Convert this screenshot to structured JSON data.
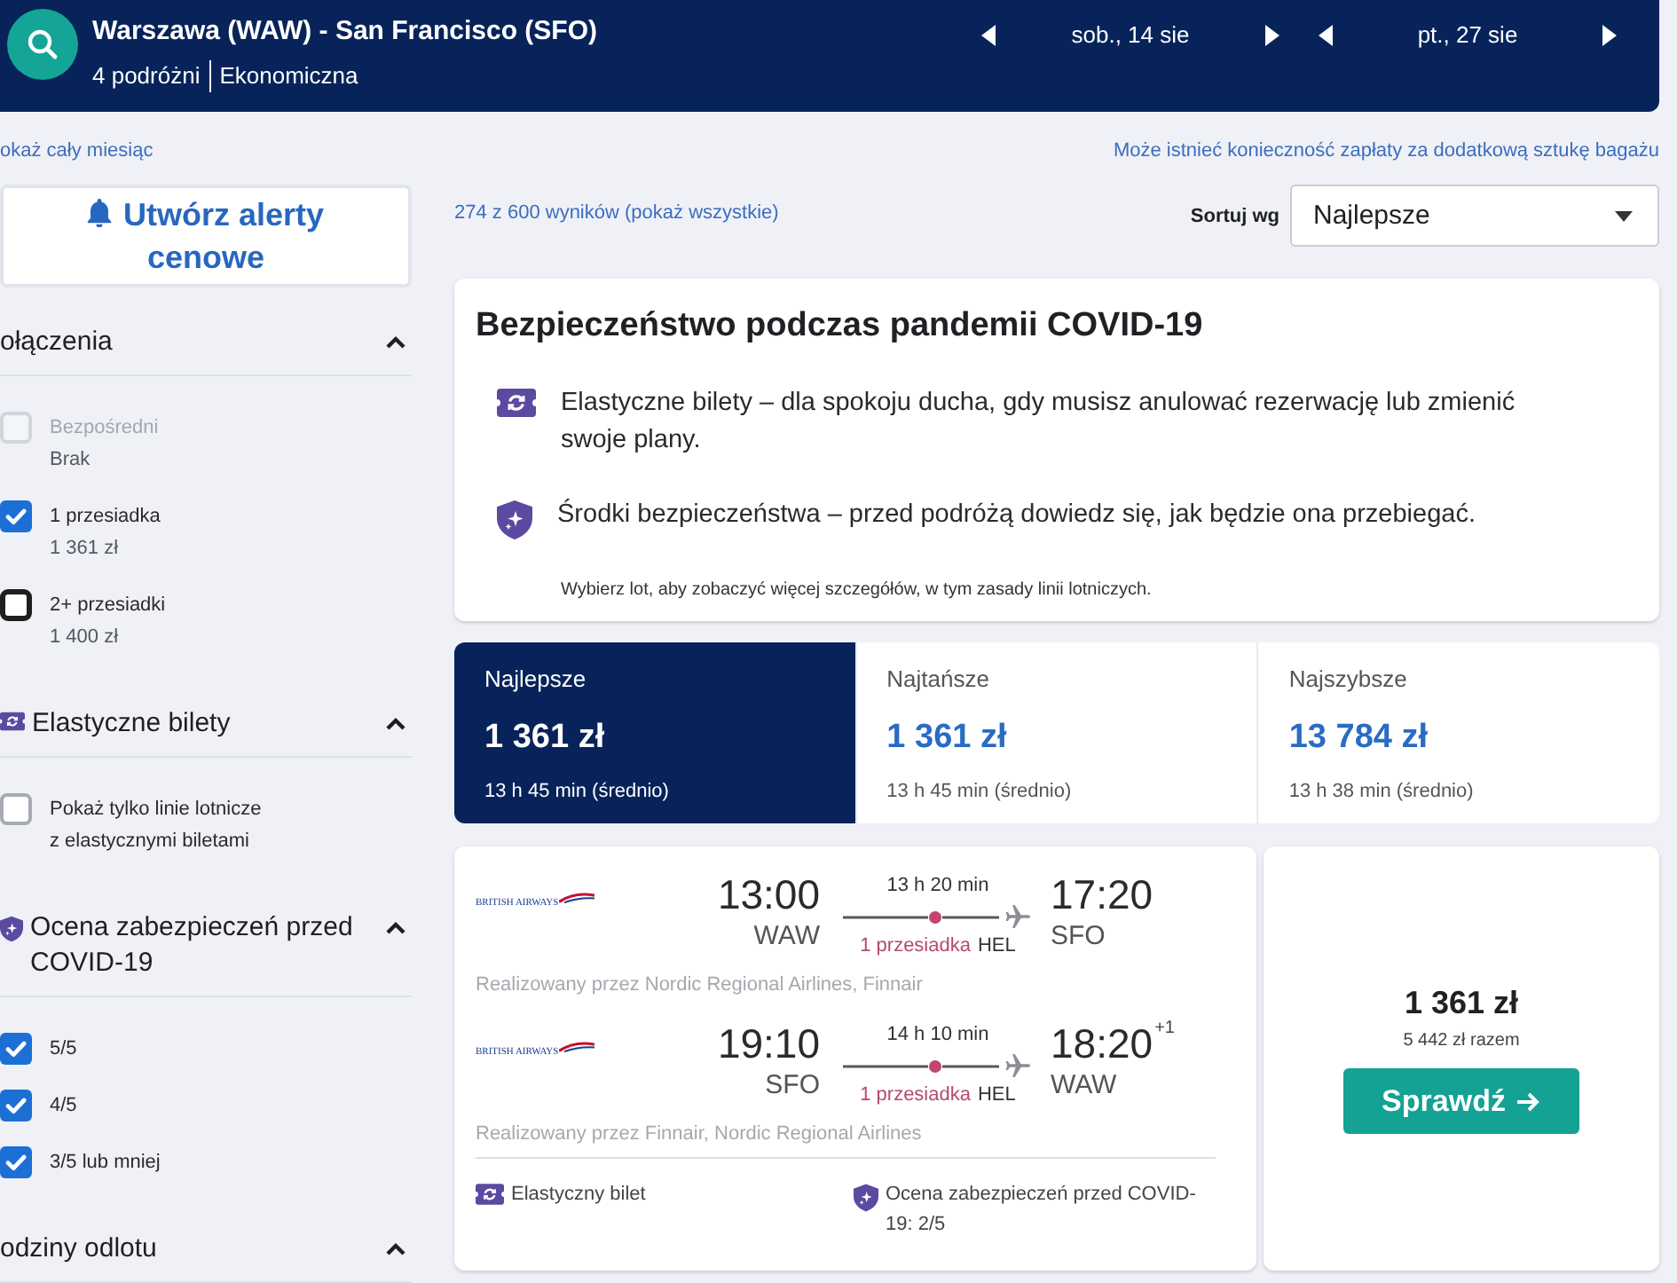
{
  "header": {
    "route": "Warszawa (WAW) - San Francisco (SFO)",
    "travellers": "4 podróżni",
    "cabin": "Ekonomiczna",
    "dates": [
      {
        "label": "sob., 14 sie"
      },
      {
        "label": "pt., 27 sie"
      }
    ]
  },
  "hints": {
    "month_link": "okaż cały miesiąc",
    "baggage_note": "Może istnieć konieczność zapłaty za dodatkową sztukę bagażu"
  },
  "sidebar": {
    "alert_button": "Utwórz alerty cenowe",
    "sections": [
      {
        "kind": "stops",
        "title": "ołączenia",
        "expanded": true,
        "options": [
          {
            "label": "Bezpośredni",
            "detail": "Brak",
            "checked": false,
            "disabled": true,
            "focused": false
          },
          {
            "label": "1 przesiadka",
            "detail": "1 361 zł",
            "checked": true,
            "disabled": false,
            "focused": false
          },
          {
            "label": "2+ przesiadki",
            "detail": "1 400 zł",
            "checked": false,
            "disabled": false,
            "focused": true
          }
        ]
      },
      {
        "kind": "flexible",
        "title": "Elastyczne bilety",
        "expanded": true,
        "options": [
          {
            "label": "Pokaż tylko linie lotnicze z elastycznymi biletami",
            "checked": false,
            "disabled": false,
            "focused": false
          }
        ]
      },
      {
        "kind": "safety",
        "title": "Ocena zabezpieczeń przed COVID-19",
        "expanded": true,
        "options": [
          {
            "label": "5/5",
            "checked": true,
            "disabled": false,
            "focused": false
          },
          {
            "label": "4/5",
            "checked": true,
            "disabled": false,
            "focused": false
          },
          {
            "label": "3/5 lub mniej",
            "checked": true,
            "disabled": false,
            "focused": false
          }
        ]
      },
      {
        "kind": "times",
        "title": "odziny odlotu",
        "expanded": true
      }
    ]
  },
  "results": {
    "count_link": "274 z 600 wyników (pokaż wszystkie)",
    "sort_label": "Sortuj wg",
    "sort_value": "Najlepsze"
  },
  "covid_card": {
    "title": "Bezpieczeństwo podczas pandemii COVID-19",
    "items": [
      {
        "kind": "flexible",
        "text": "Elastyczne bilety – dla spokoju ducha, gdy musisz anulować rezerwację lub zmienić swoje plany."
      },
      {
        "kind": "safety",
        "text": "Środki bezpieczeństwa – przed podróżą dowiedz się, jak będzie ona przebiegać."
      }
    ],
    "note": "Wybierz lot, aby zobaczyć więcej szczegółów, w tym zasady linii lotniczych."
  },
  "sort_tabs": [
    {
      "label": "Najlepsze",
      "price": "1 361 zł",
      "duration": "13 h 45 min (średnio)",
      "selected": true
    },
    {
      "label": "Najtańsze",
      "price": "1 361 zł",
      "duration": "13 h 45 min (średnio)",
      "selected": false
    },
    {
      "label": "Najszybsze",
      "price": "13 784 zł",
      "duration": "13 h 38 min (średnio)",
      "selected": false
    }
  ],
  "flights": [
    {
      "legs": [
        {
          "airline": "BRITISH AIRWAYS",
          "depart_time": "13:00",
          "depart_code": "WAW",
          "duration": "13 h 20 min",
          "stops": "1 przesiadka",
          "via": "HEL",
          "arrive_time": "17:20",
          "arrive_code": "SFO",
          "operated_by": "Realizowany przez Nordic Regional Airlines, Finnair"
        },
        {
          "airline": "BRITISH AIRWAYS",
          "depart_time": "19:10",
          "depart_code": "SFO",
          "duration": "14 h 10 min",
          "stops": "1 przesiadka",
          "via": "HEL",
          "arrive_time": "18:20",
          "day_offset": "+1",
          "arrive_code": "WAW",
          "operated_by": "Realizowany przez Finnair, Nordic Regional Airlines"
        }
      ],
      "features": [
        {
          "kind": "flexible",
          "text": "Elastyczny bilet"
        },
        {
          "kind": "safety",
          "text": "Ocena zabezpieczeń przed COVID-19: 2/5"
        }
      ],
      "price": "1 361 zł",
      "total": "5 442 zł razem",
      "button": "Sprawdź"
    }
  ]
}
